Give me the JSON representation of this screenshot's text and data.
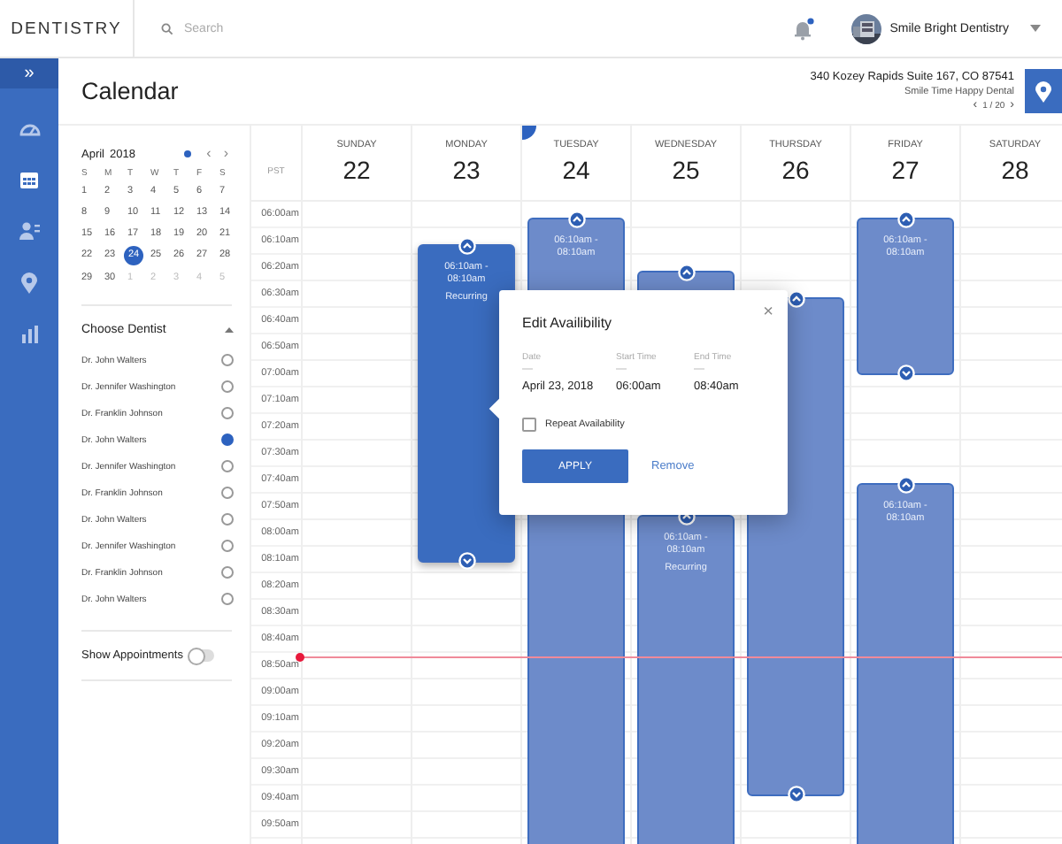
{
  "topbar": {
    "logo": "DENTISTRY",
    "search_placeholder": "Search",
    "notification_unread": true,
    "account": "Smile Bright Dentistry"
  },
  "nav": {
    "expand": "»",
    "items": [
      {
        "kind": "dashboard",
        "selected": false
      },
      {
        "kind": "calendar",
        "selected": true
      },
      {
        "kind": "patients",
        "selected": false
      },
      {
        "kind": "location",
        "selected": false
      },
      {
        "kind": "chart",
        "selected": false
      }
    ]
  },
  "page": {
    "title": "Calendar",
    "address": "340 Kozey Rapids Suite 167, CO 87541",
    "location_name": "Smile Time Happy Dental",
    "prev": "‹",
    "pager": "1 / 20",
    "next": "›"
  },
  "mini_calendar": {
    "month": "April",
    "year": "2018",
    "today_dot": true,
    "prev": "‹",
    "next": "›",
    "weekdays": [
      "S",
      "M",
      "T",
      "W",
      "T",
      "F",
      "S"
    ],
    "days": [
      {
        "label": "1",
        "muted": false,
        "selected": false
      },
      {
        "label": "2",
        "muted": false,
        "selected": false
      },
      {
        "label": "3",
        "muted": false,
        "selected": false
      },
      {
        "label": "4",
        "muted": false,
        "selected": false
      },
      {
        "label": "5",
        "muted": false,
        "selected": false
      },
      {
        "label": "6",
        "muted": false,
        "selected": false
      },
      {
        "label": "7",
        "muted": false,
        "selected": false
      },
      {
        "label": "8",
        "muted": false,
        "selected": false
      },
      {
        "label": "9",
        "muted": false,
        "selected": false
      },
      {
        "label": "10",
        "muted": false,
        "selected": false
      },
      {
        "label": "11",
        "muted": false,
        "selected": false
      },
      {
        "label": "12",
        "muted": false,
        "selected": false
      },
      {
        "label": "13",
        "muted": false,
        "selected": false
      },
      {
        "label": "14",
        "muted": false,
        "selected": false
      },
      {
        "label": "15",
        "muted": false,
        "selected": false
      },
      {
        "label": "16",
        "muted": false,
        "selected": false
      },
      {
        "label": "17",
        "muted": false,
        "selected": false
      },
      {
        "label": "18",
        "muted": false,
        "selected": false
      },
      {
        "label": "19",
        "muted": false,
        "selected": false
      },
      {
        "label": "20",
        "muted": false,
        "selected": false
      },
      {
        "label": "21",
        "muted": false,
        "selected": false
      },
      {
        "label": "22",
        "muted": false,
        "selected": false
      },
      {
        "label": "23",
        "muted": false,
        "selected": false
      },
      {
        "label": "24",
        "muted": false,
        "selected": true
      },
      {
        "label": "25",
        "muted": false,
        "selected": false
      },
      {
        "label": "26",
        "muted": false,
        "selected": false
      },
      {
        "label": "27",
        "muted": false,
        "selected": false
      },
      {
        "label": "28",
        "muted": false,
        "selected": false
      },
      {
        "label": "29",
        "muted": false,
        "selected": false
      },
      {
        "label": "30",
        "muted": false,
        "selected": false
      },
      {
        "label": "1",
        "muted": true,
        "selected": false
      },
      {
        "label": "2",
        "muted": true,
        "selected": false
      },
      {
        "label": "3",
        "muted": true,
        "selected": false
      },
      {
        "label": "4",
        "muted": true,
        "selected": false
      },
      {
        "label": "5",
        "muted": true,
        "selected": false
      }
    ]
  },
  "dentists": {
    "title": "Choose Dentist",
    "expanded": true,
    "items": [
      {
        "name": "Dr. John Walters",
        "selected": false
      },
      {
        "name": "Dr. Jennifer Washington",
        "selected": false
      },
      {
        "name": "Dr. Franklin Johnson",
        "selected": false
      },
      {
        "name": "Dr. John Walters",
        "selected": true
      },
      {
        "name": "Dr. Jennifer Washington",
        "selected": false
      },
      {
        "name": "Dr. Franklin Johnson",
        "selected": false
      },
      {
        "name": "Dr. John Walters",
        "selected": false
      },
      {
        "name": "Dr. Jennifer Washington",
        "selected": false
      },
      {
        "name": "Dr. Franklin Johnson",
        "selected": false
      },
      {
        "name": "Dr. John Walters",
        "selected": false
      }
    ]
  },
  "show_appointments": {
    "label": "Show Appointments",
    "on": false
  },
  "calendar": {
    "timezone": "PST",
    "times": [
      "06:00am",
      "06:10am",
      "06:20am",
      "06:30am",
      "06:40am",
      "06:50am",
      "07:00am",
      "07:10am",
      "07:20am",
      "07:30am",
      "07:40am",
      "07:50am",
      "08:00am",
      "08:10am",
      "08:20am",
      "08:30am",
      "08:40am",
      "08:50am",
      "09:00am",
      "09:10am",
      "09:20am",
      "09:30am",
      "09:40am",
      "09:50am"
    ],
    "days": [
      {
        "weekday": "SUNDAY",
        "date": "22",
        "marked": false
      },
      {
        "weekday": "MONDAY",
        "date": "23",
        "marked": false,
        "events": [
          {
            "active": true,
            "top_handle": true,
            "bottom_handle": true,
            "time": "06:10am - 08:10am",
            "note": "Recurring"
          }
        ]
      },
      {
        "weekday": "TUESDAY",
        "date": "24",
        "marked": true,
        "events": [
          {
            "active": false,
            "top_handle": true,
            "time": "06:10am - 08:10am"
          }
        ]
      },
      {
        "weekday": "WEDNESDAY",
        "date": "25",
        "marked": false,
        "events": [
          {
            "active": false,
            "top_handle": true
          },
          {
            "active": false,
            "top_handle": true,
            "time": "06:10am - 08:10am",
            "note": "Recurring"
          }
        ]
      },
      {
        "weekday": "THURSDAY",
        "date": "26",
        "marked": false,
        "events": [
          {
            "active": false,
            "top_handle": true,
            "bottom_handle": true
          }
        ]
      },
      {
        "weekday": "FRIDAY",
        "date": "27",
        "marked": false,
        "events": [
          {
            "active": false,
            "top_handle": true,
            "bottom_handle": true,
            "time": "06:10am - 08:10am"
          },
          {
            "active": false,
            "top_handle": true,
            "time": "06:10am - 08:10am"
          }
        ]
      },
      {
        "weekday": "SATURDAY",
        "date": "28",
        "marked": false
      }
    ]
  },
  "dialog": {
    "title": "Edit Availibility",
    "close": "×",
    "fields": [
      {
        "label": "Date",
        "value": "April 23, 2018"
      },
      {
        "label": "Start Time",
        "value": "06:00am"
      },
      {
        "label": "End Time",
        "value": "08:40am"
      }
    ],
    "repeat": {
      "label": "Repeat Availability",
      "checked": false
    },
    "primary": "APPLY",
    "secondary": "Remove"
  }
}
